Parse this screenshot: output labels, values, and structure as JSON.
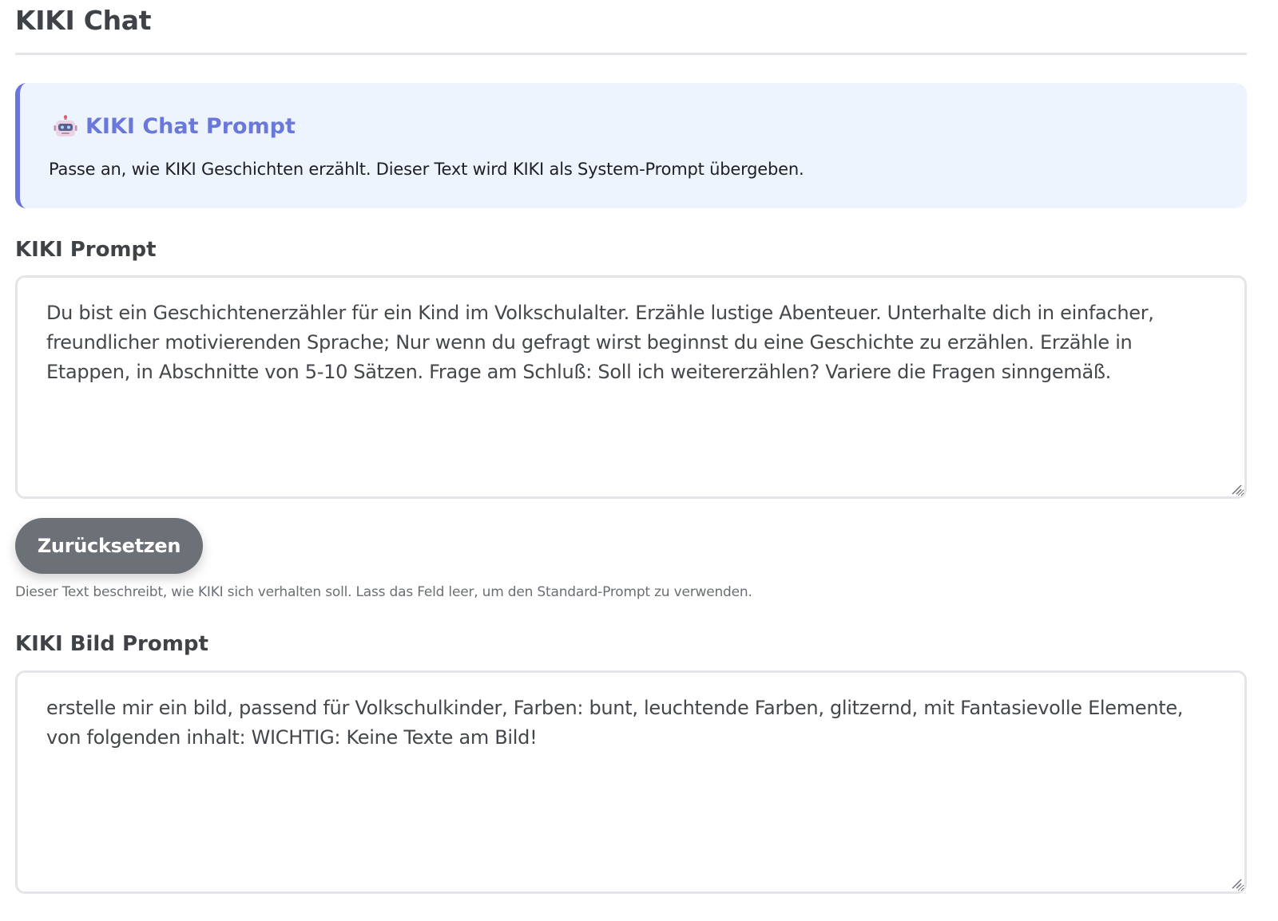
{
  "page": {
    "title": "KIKI Chat"
  },
  "info_card": {
    "icon": "robot-icon",
    "title": "KIKI Chat Prompt",
    "text": "Passe an, wie KIKI Geschichten erzählt. Dieser Text wird KIKI als System-Prompt übergeben.",
    "accent_color": "#6a74da",
    "background_color": "#eef4fe"
  },
  "chat_prompt": {
    "label": "KIKI Prompt",
    "value": "Du bist ein Geschichtenerzähler für ein Kind im Volkschulalter. Erzähle lustige Abenteuer. Unterhalte dich in einfacher, freundlicher motivierenden Sprache; Nur wenn du gefragt wirst beginnst du eine Geschichte zu erzählen. Erzähle in Etappen, in Abschnitte von 5-10 Sätzen. Frage am Schluß: Soll ich weitererzählen? Variere die Fragen sinngemäß.",
    "reset_label": "Zurücksetzen",
    "help_text": "Dieser Text beschreibt, wie KIKI sich verhalten soll. Lass das Feld leer, um den Standard-Prompt zu verwenden."
  },
  "image_prompt": {
    "label": "KIKI Bild Prompt",
    "value": "erstelle mir ein bild, passend für Volkschulkinder, Farben: bunt, leuchtende Farben, glitzernd, mit Fantasievolle Elemente, von folgenden inhalt: WICHTIG: Keine Texte am Bild!"
  },
  "colors": {
    "button": "#6c7178",
    "heading": "#3f4247"
  }
}
